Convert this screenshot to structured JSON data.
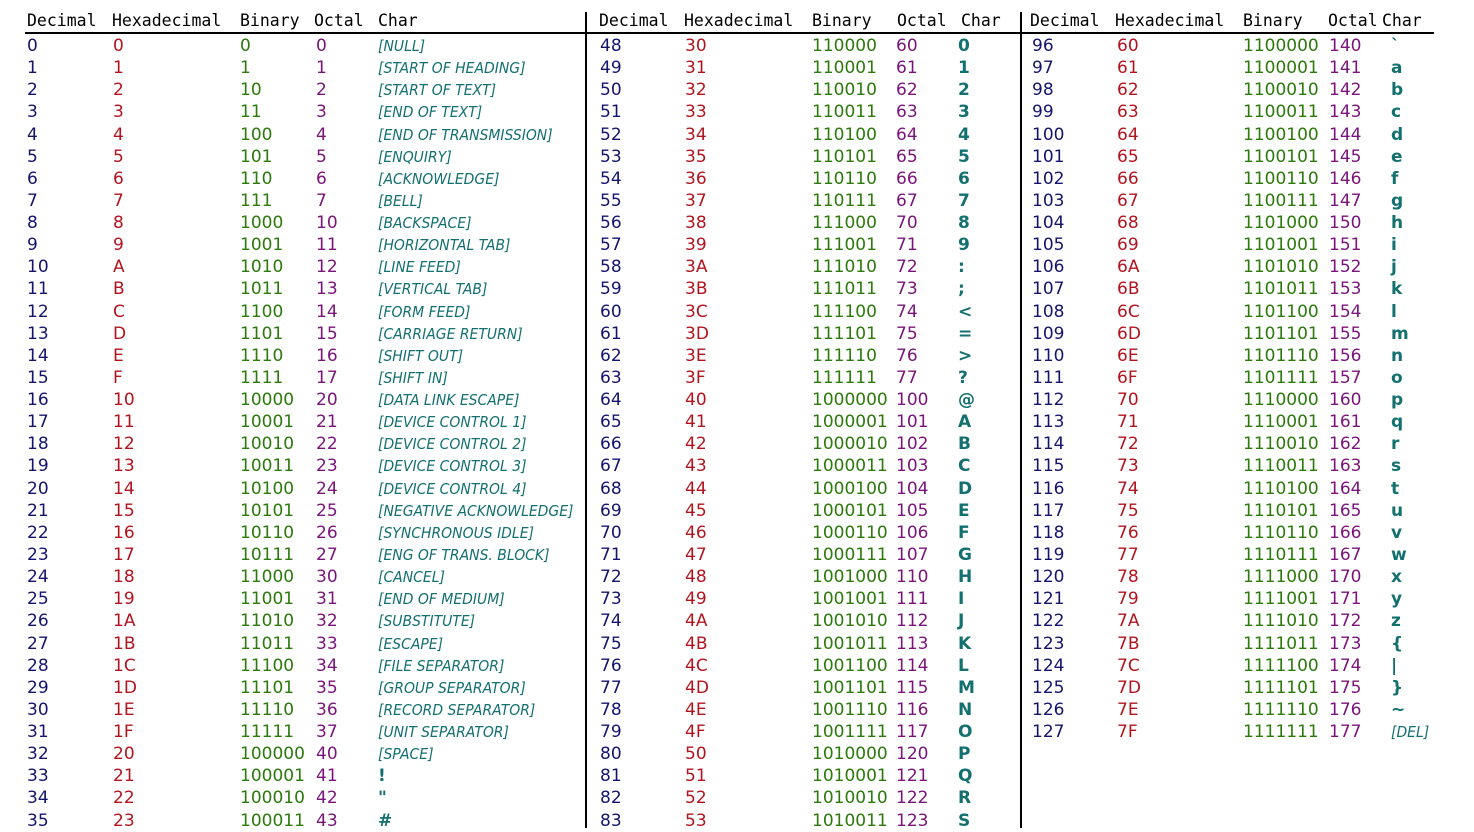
{
  "table": {
    "headers": [
      "Decimal",
      "Hexadecimal",
      "Binary",
      "Octal",
      "Char"
    ],
    "colors": {
      "decimal": "#14146e",
      "hexadecimal": "#b2141e",
      "binary": "#2b7a0b",
      "octal": "#7a137a",
      "char": "#137070"
    },
    "blocks": [
      {
        "rows": [
          [
            "0",
            "0",
            "0",
            "0",
            "[NULL]"
          ],
          [
            "1",
            "1",
            "1",
            "1",
            "[START OF HEADING]"
          ],
          [
            "2",
            "2",
            "10",
            "2",
            "[START OF TEXT]"
          ],
          [
            "3",
            "3",
            "11",
            "3",
            "[END OF TEXT]"
          ],
          [
            "4",
            "4",
            "100",
            "4",
            "[END OF TRANSMISSION]"
          ],
          [
            "5",
            "5",
            "101",
            "5",
            "[ENQUIRY]"
          ],
          [
            "6",
            "6",
            "110",
            "6",
            "[ACKNOWLEDGE]"
          ],
          [
            "7",
            "7",
            "111",
            "7",
            "[BELL]"
          ],
          [
            "8",
            "8",
            "1000",
            "10",
            "[BACKSPACE]"
          ],
          [
            "9",
            "9",
            "1001",
            "11",
            "[HORIZONTAL TAB]"
          ],
          [
            "10",
            "A",
            "1010",
            "12",
            "[LINE FEED]"
          ],
          [
            "11",
            "B",
            "1011",
            "13",
            "[VERTICAL TAB]"
          ],
          [
            "12",
            "C",
            "1100",
            "14",
            "[FORM FEED]"
          ],
          [
            "13",
            "D",
            "1101",
            "15",
            "[CARRIAGE RETURN]"
          ],
          [
            "14",
            "E",
            "1110",
            "16",
            "[SHIFT OUT]"
          ],
          [
            "15",
            "F",
            "1111",
            "17",
            "[SHIFT IN]"
          ],
          [
            "16",
            "10",
            "10000",
            "20",
            "[DATA LINK ESCAPE]"
          ],
          [
            "17",
            "11",
            "10001",
            "21",
            "[DEVICE CONTROL 1]"
          ],
          [
            "18",
            "12",
            "10010",
            "22",
            "[DEVICE CONTROL 2]"
          ],
          [
            "19",
            "13",
            "10011",
            "23",
            "[DEVICE CONTROL 3]"
          ],
          [
            "20",
            "14",
            "10100",
            "24",
            "[DEVICE CONTROL 4]"
          ],
          [
            "21",
            "15",
            "10101",
            "25",
            "[NEGATIVE ACKNOWLEDGE]"
          ],
          [
            "22",
            "16",
            "10110",
            "26",
            "[SYNCHRONOUS IDLE]"
          ],
          [
            "23",
            "17",
            "10111",
            "27",
            "[ENG OF TRANS. BLOCK]"
          ],
          [
            "24",
            "18",
            "11000",
            "30",
            "[CANCEL]"
          ],
          [
            "25",
            "19",
            "11001",
            "31",
            "[END OF MEDIUM]"
          ],
          [
            "26",
            "1A",
            "11010",
            "32",
            "[SUBSTITUTE]"
          ],
          [
            "27",
            "1B",
            "11011",
            "33",
            "[ESCAPE]"
          ],
          [
            "28",
            "1C",
            "11100",
            "34",
            "[FILE SEPARATOR]"
          ],
          [
            "29",
            "1D",
            "11101",
            "35",
            "[GROUP SEPARATOR]"
          ],
          [
            "30",
            "1E",
            "11110",
            "36",
            "[RECORD SEPARATOR]"
          ],
          [
            "31",
            "1F",
            "11111",
            "37",
            "[UNIT SEPARATOR]"
          ],
          [
            "32",
            "20",
            "100000",
            "40",
            "[SPACE]"
          ],
          [
            "33",
            "21",
            "100001",
            "41",
            "!"
          ],
          [
            "34",
            "22",
            "100010",
            "42",
            "\""
          ],
          [
            "35",
            "23",
            "100011",
            "43",
            "#"
          ]
        ]
      },
      {
        "rows": [
          [
            "48",
            "30",
            "110000",
            "60",
            "0"
          ],
          [
            "49",
            "31",
            "110001",
            "61",
            "1"
          ],
          [
            "50",
            "32",
            "110010",
            "62",
            "2"
          ],
          [
            "51",
            "33",
            "110011",
            "63",
            "3"
          ],
          [
            "52",
            "34",
            "110100",
            "64",
            "4"
          ],
          [
            "53",
            "35",
            "110101",
            "65",
            "5"
          ],
          [
            "54",
            "36",
            "110110",
            "66",
            "6"
          ],
          [
            "55",
            "37",
            "110111",
            "67",
            "7"
          ],
          [
            "56",
            "38",
            "111000",
            "70",
            "8"
          ],
          [
            "57",
            "39",
            "111001",
            "71",
            "9"
          ],
          [
            "58",
            "3A",
            "111010",
            "72",
            ":"
          ],
          [
            "59",
            "3B",
            "111011",
            "73",
            ";"
          ],
          [
            "60",
            "3C",
            "111100",
            "74",
            "<"
          ],
          [
            "61",
            "3D",
            "111101",
            "75",
            "="
          ],
          [
            "62",
            "3E",
            "111110",
            "76",
            ">"
          ],
          [
            "63",
            "3F",
            "111111",
            "77",
            "?"
          ],
          [
            "64",
            "40",
            "1000000",
            "100",
            "@"
          ],
          [
            "65",
            "41",
            "1000001",
            "101",
            "A"
          ],
          [
            "66",
            "42",
            "1000010",
            "102",
            "B"
          ],
          [
            "67",
            "43",
            "1000011",
            "103",
            "C"
          ],
          [
            "68",
            "44",
            "1000100",
            "104",
            "D"
          ],
          [
            "69",
            "45",
            "1000101",
            "105",
            "E"
          ],
          [
            "70",
            "46",
            "1000110",
            "106",
            "F"
          ],
          [
            "71",
            "47",
            "1000111",
            "107",
            "G"
          ],
          [
            "72",
            "48",
            "1001000",
            "110",
            "H"
          ],
          [
            "73",
            "49",
            "1001001",
            "111",
            "I"
          ],
          [
            "74",
            "4A",
            "1001010",
            "112",
            "J"
          ],
          [
            "75",
            "4B",
            "1001011",
            "113",
            "K"
          ],
          [
            "76",
            "4C",
            "1001100",
            "114",
            "L"
          ],
          [
            "77",
            "4D",
            "1001101",
            "115",
            "M"
          ],
          [
            "78",
            "4E",
            "1001110",
            "116",
            "N"
          ],
          [
            "79",
            "4F",
            "1001111",
            "117",
            "O"
          ],
          [
            "80",
            "50",
            "1010000",
            "120",
            "P"
          ],
          [
            "81",
            "51",
            "1010001",
            "121",
            "Q"
          ],
          [
            "82",
            "52",
            "1010010",
            "122",
            "R"
          ],
          [
            "83",
            "53",
            "1010011",
            "123",
            "S"
          ]
        ]
      },
      {
        "rows": [
          [
            "96",
            "60",
            "1100000",
            "140",
            "`"
          ],
          [
            "97",
            "61",
            "1100001",
            "141",
            "a"
          ],
          [
            "98",
            "62",
            "1100010",
            "142",
            "b"
          ],
          [
            "99",
            "63",
            "1100011",
            "143",
            "c"
          ],
          [
            "100",
            "64",
            "1100100",
            "144",
            "d"
          ],
          [
            "101",
            "65",
            "1100101",
            "145",
            "e"
          ],
          [
            "102",
            "66",
            "1100110",
            "146",
            "f"
          ],
          [
            "103",
            "67",
            "1100111",
            "147",
            "g"
          ],
          [
            "104",
            "68",
            "1101000",
            "150",
            "h"
          ],
          [
            "105",
            "69",
            "1101001",
            "151",
            "i"
          ],
          [
            "106",
            "6A",
            "1101010",
            "152",
            "j"
          ],
          [
            "107",
            "6B",
            "1101011",
            "153",
            "k"
          ],
          [
            "108",
            "6C",
            "1101100",
            "154",
            "l"
          ],
          [
            "109",
            "6D",
            "1101101",
            "155",
            "m"
          ],
          [
            "110",
            "6E",
            "1101110",
            "156",
            "n"
          ],
          [
            "111",
            "6F",
            "1101111",
            "157",
            "o"
          ],
          [
            "112",
            "70",
            "1110000",
            "160",
            "p"
          ],
          [
            "113",
            "71",
            "1110001",
            "161",
            "q"
          ],
          [
            "114",
            "72",
            "1110010",
            "162",
            "r"
          ],
          [
            "115",
            "73",
            "1110011",
            "163",
            "s"
          ],
          [
            "116",
            "74",
            "1110100",
            "164",
            "t"
          ],
          [
            "117",
            "75",
            "1110101",
            "165",
            "u"
          ],
          [
            "118",
            "76",
            "1110110",
            "166",
            "v"
          ],
          [
            "119",
            "77",
            "1110111",
            "167",
            "w"
          ],
          [
            "120",
            "78",
            "1111000",
            "170",
            "x"
          ],
          [
            "121",
            "79",
            "1111001",
            "171",
            "y"
          ],
          [
            "122",
            "7A",
            "1111010",
            "172",
            "z"
          ],
          [
            "123",
            "7B",
            "1111011",
            "173",
            "{"
          ],
          [
            "124",
            "7C",
            "1111100",
            "174",
            "|"
          ],
          [
            "125",
            "7D",
            "1111101",
            "175",
            "}"
          ],
          [
            "126",
            "7E",
            "1111110",
            "176",
            "~"
          ],
          [
            "127",
            "7F",
            "1111111",
            "177",
            "[DEL]"
          ]
        ]
      }
    ]
  }
}
